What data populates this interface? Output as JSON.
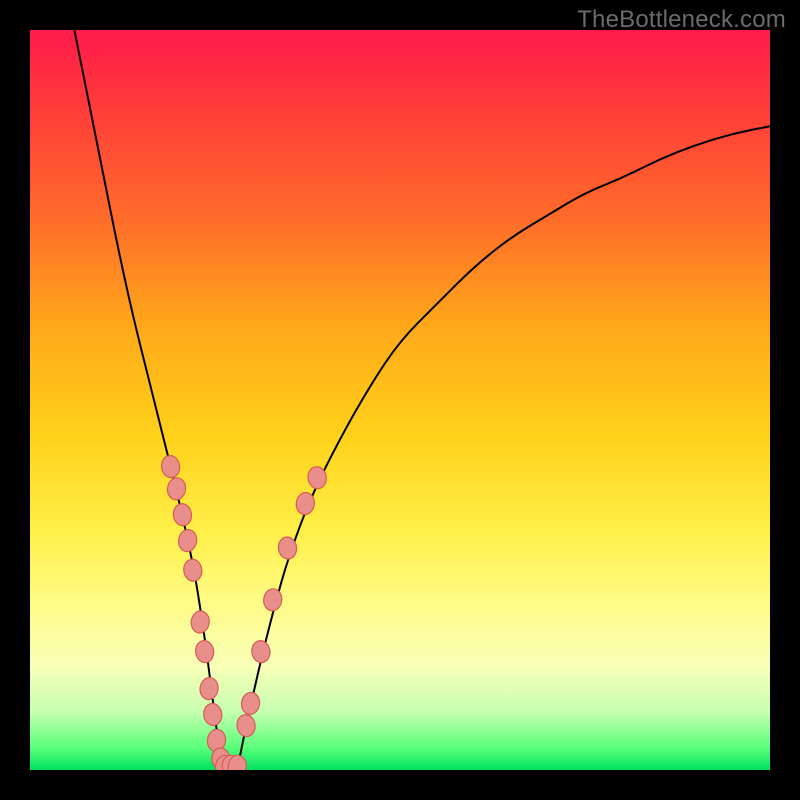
{
  "watermark": "TheBottleneck.com",
  "chart_data": {
    "type": "line",
    "title": "",
    "xlabel": "",
    "ylabel": "",
    "xlim": [
      0,
      100
    ],
    "ylim": [
      0,
      100
    ],
    "series": [
      {
        "name": "curve",
        "x": [
          6,
          8,
          10,
          12,
          14,
          16,
          18,
          20,
          22,
          23,
          24,
          25,
          26,
          27,
          28,
          29,
          31,
          33,
          35,
          38,
          42,
          46,
          50,
          55,
          60,
          65,
          70,
          75,
          80,
          85,
          90,
          95,
          100
        ],
        "y": [
          100,
          90,
          80,
          70,
          61,
          53,
          45,
          37,
          28,
          22,
          15,
          7,
          0,
          0,
          0,
          5,
          14,
          22,
          29,
          37,
          45,
          52,
          58,
          63,
          68,
          72,
          75,
          78,
          80,
          82.5,
          84.5,
          86,
          87
        ]
      }
    ],
    "markers": {
      "left_branch": [
        {
          "x": 19,
          "y": 41
        },
        {
          "x": 19.8,
          "y": 38
        },
        {
          "x": 20.6,
          "y": 34.5
        },
        {
          "x": 21.3,
          "y": 31
        },
        {
          "x": 22,
          "y": 27
        },
        {
          "x": 23,
          "y": 20
        },
        {
          "x": 23.6,
          "y": 16
        },
        {
          "x": 24.2,
          "y": 11
        },
        {
          "x": 24.7,
          "y": 7.5
        },
        {
          "x": 25.2,
          "y": 4
        },
        {
          "x": 25.8,
          "y": 1.5
        }
      ],
      "bottom": [
        {
          "x": 26.3,
          "y": 0.5
        },
        {
          "x": 27.2,
          "y": 0.5
        },
        {
          "x": 28.0,
          "y": 0.5
        }
      ],
      "right_branch": [
        {
          "x": 29.2,
          "y": 6
        },
        {
          "x": 29.8,
          "y": 9
        },
        {
          "x": 31.2,
          "y": 16
        },
        {
          "x": 32.8,
          "y": 23
        },
        {
          "x": 34.8,
          "y": 30
        },
        {
          "x": 37.2,
          "y": 36
        },
        {
          "x": 38.8,
          "y": 39.5
        }
      ]
    },
    "gradient_stops": [
      {
        "pos": 0,
        "color": "#ff1a4a"
      },
      {
        "pos": 25,
        "color": "#ff6a2a"
      },
      {
        "pos": 55,
        "color": "#ffd21a"
      },
      {
        "pos": 78,
        "color": "#fffc8a"
      },
      {
        "pos": 97,
        "color": "#5aff7a"
      },
      {
        "pos": 100,
        "color": "#00e060"
      }
    ]
  }
}
